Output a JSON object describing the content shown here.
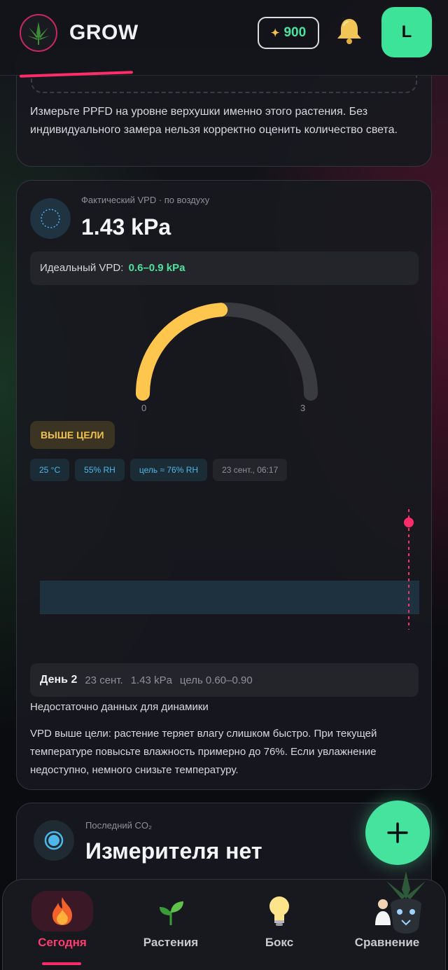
{
  "header": {
    "brand": "GROW",
    "coins": "900",
    "avatar_letter": "L",
    "colors": {
      "accent_green": "#46e39f",
      "accent_pink": "#ff2c6a"
    }
  },
  "top_card": {
    "text": "Измерьте PPFD на уровне верхушки именно этого растения. Без индивидуального замера нельзя корректно оценить количество света."
  },
  "vpd_card": {
    "caption": "Фактический VPD · по воздуху",
    "value": "1.43 kPa",
    "ideal_label": "Идеальный VPD:",
    "ideal_range": "0.6–0.9 kPa",
    "gauge": {
      "min_label": "0",
      "max_label": "3",
      "min": 0,
      "max": 3,
      "value": 1.43
    },
    "status": "ВЫШЕ ЦЕЛИ",
    "chips": [
      "25 °C",
      "55% RH",
      "цель ≈ 76% RH",
      "23 сент., 06:17"
    ],
    "day_row": {
      "day": "День 2",
      "date": "23 сент.",
      "value": "1.43 kPa",
      "target": "цель 0.60–0.90"
    },
    "no_data": "Недостаточно данных для динамики",
    "advice": "VPD выше цели: растение теряет влагу слишком быстро. При текущей температуре повысьте влажность примерно до 76%. Если увлажнение недоступно, немного снизьте температуру."
  },
  "co2_card": {
    "caption": "Последний CO₂",
    "value": "Измерителя нет"
  },
  "nav": {
    "items": [
      {
        "label": "Сегодня",
        "icon": "fire-icon"
      },
      {
        "label": "Растения",
        "icon": "sprout-icon"
      },
      {
        "label": "Бокс",
        "icon": "lightbulb-icon"
      },
      {
        "label": "Сравнение",
        "icon": "scientist-icon"
      }
    ]
  }
}
